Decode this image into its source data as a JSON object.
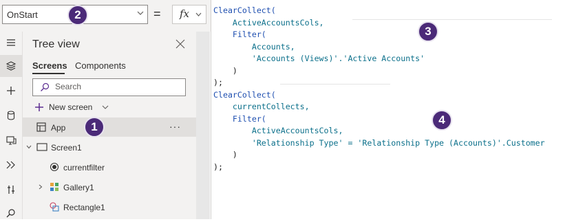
{
  "formula_bar": {
    "property": "OnStart",
    "equals": "=",
    "fx": "fx"
  },
  "rail": {
    "icons": [
      "hamburger-icon",
      "layers-icon",
      "add-icon",
      "data-icon",
      "media-icon",
      "advanced-tools-icon",
      "tools-icon",
      "search-icon"
    ]
  },
  "tree_view": {
    "title": "Tree view",
    "tabs": [
      {
        "label": "Screens",
        "selected": true
      },
      {
        "label": "Components",
        "selected": false
      }
    ],
    "search_placeholder": "Search",
    "new_screen_label": "New screen",
    "items": [
      {
        "label": "App",
        "icon": "app-icon",
        "selected": true,
        "more": "···"
      },
      {
        "label": "Screen1",
        "icon": "screen-icon",
        "expanded": true
      },
      {
        "label": "currentfilter",
        "icon": "radio-control-icon"
      },
      {
        "label": "Gallery1",
        "icon": "gallery-icon",
        "collapsed": true
      },
      {
        "label": "Rectangle1",
        "icon": "rectangle-icon"
      }
    ]
  },
  "code": {
    "lines": [
      "ClearCollect(",
      "    ActiveAccountsCols,",
      "    Filter(",
      "        Accounts,",
      "        'Accounts (Views)'.'Active Accounts'",
      "    )",
      ");",
      "ClearCollect(",
      "    currentCollects,",
      "    Filter(",
      "        ActiveAccountsCols,",
      "        'Relationship Type' = 'Relationship Type (Accounts)'.Customer",
      "    )",
      ");"
    ]
  },
  "callouts": [
    "1",
    "2",
    "3",
    "4"
  ],
  "colors": {
    "badge": "#4b2a78",
    "function_blue": "#1f4fb0",
    "identifier_teal": "#0a6f8a",
    "panel_bg": "#f3f2f1"
  }
}
